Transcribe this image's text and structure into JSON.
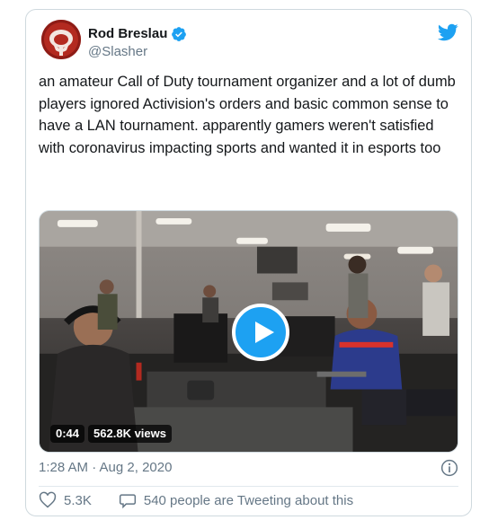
{
  "user": {
    "name": "Rod Breslau",
    "handle": "@Slasher",
    "verified": true
  },
  "tweet": {
    "text": "an amateur Call of Duty tournament organizer and a lot of dumb players ignored Activision's orders and basic common sense to have a LAN tournament. apparently gamers weren't satisfied with coronavirus impacting sports and wanted it in esports too",
    "timestamp": "1:28 AM · Aug 2, 2020"
  },
  "video": {
    "duration": "0:44",
    "views": "562.8K views"
  },
  "actions": {
    "likes": "5.3K",
    "conversation": "540 people are Tweeting about this"
  },
  "colors": {
    "brand": "#1da1f2",
    "text": "#14171a",
    "secondary_text": "#657786",
    "border": "#cfd9de"
  },
  "icons": [
    "twitter-bird-icon",
    "verified-badge-icon",
    "play-icon",
    "info-icon",
    "heart-icon",
    "speech-bubble-icon"
  ]
}
